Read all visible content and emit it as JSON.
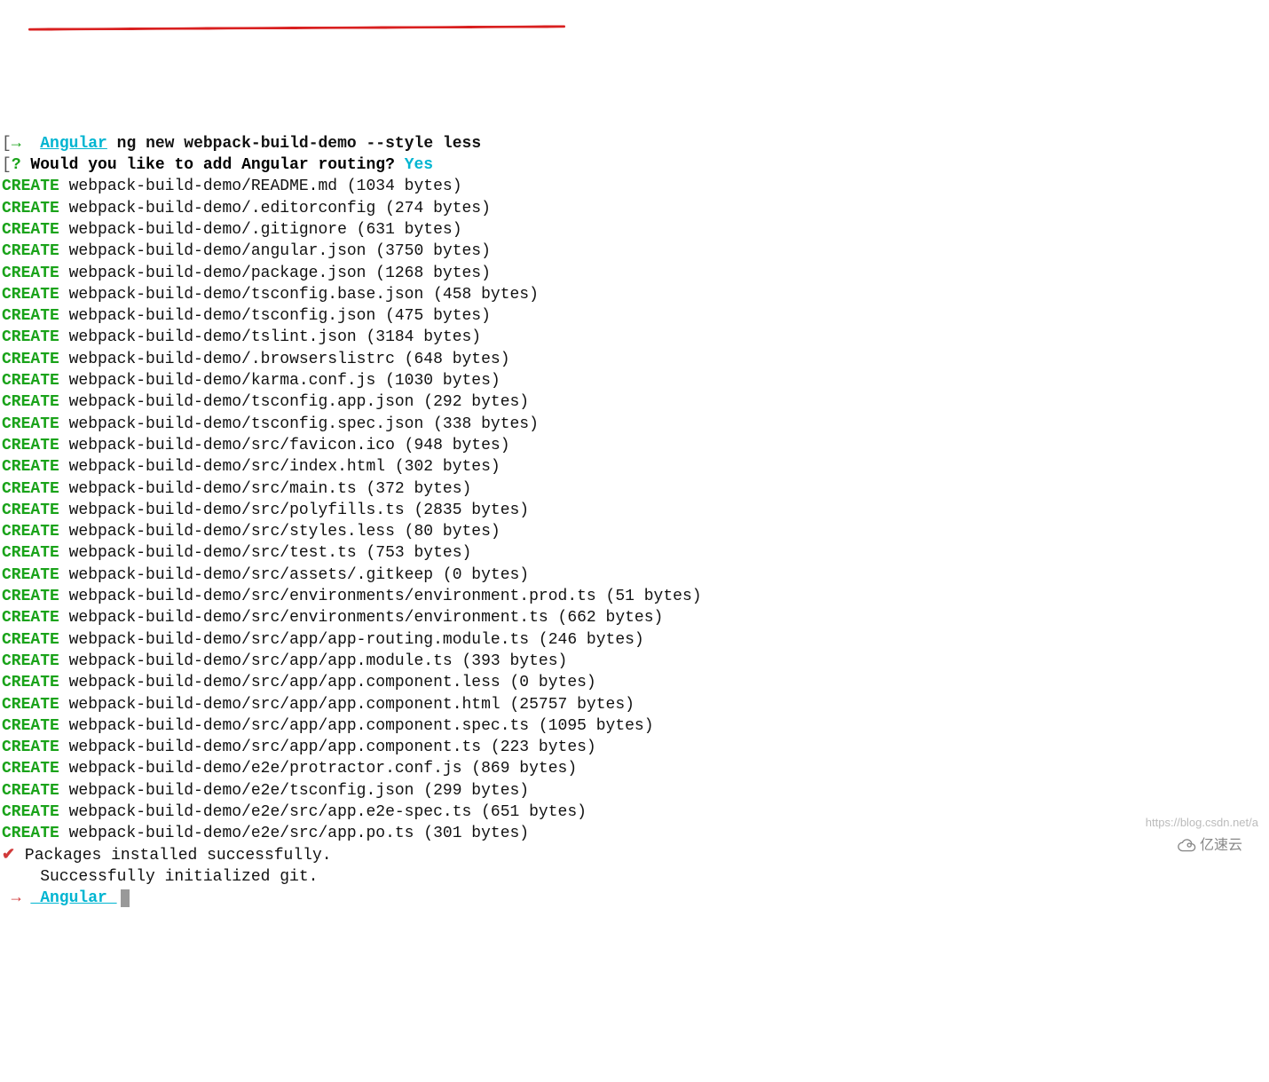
{
  "prompt1": {
    "bracket": "[",
    "arrow": "→",
    "label": "Angular",
    "command": " ng new webpack-build-demo --style less"
  },
  "prompt_question": {
    "bracket": "[",
    "qmark": "?",
    "text": " Would you like to add Angular routing?",
    "answer": " Yes"
  },
  "create_label": "CREATE",
  "files": [
    "webpack-build-demo/README.md (1034 bytes)",
    "webpack-build-demo/.editorconfig (274 bytes)",
    "webpack-build-demo/.gitignore (631 bytes)",
    "webpack-build-demo/angular.json (3750 bytes)",
    "webpack-build-demo/package.json (1268 bytes)",
    "webpack-build-demo/tsconfig.base.json (458 bytes)",
    "webpack-build-demo/tsconfig.json (475 bytes)",
    "webpack-build-demo/tslint.json (3184 bytes)",
    "webpack-build-demo/.browserslistrc (648 bytes)",
    "webpack-build-demo/karma.conf.js (1030 bytes)",
    "webpack-build-demo/tsconfig.app.json (292 bytes)",
    "webpack-build-demo/tsconfig.spec.json (338 bytes)",
    "webpack-build-demo/src/favicon.ico (948 bytes)",
    "webpack-build-demo/src/index.html (302 bytes)",
    "webpack-build-demo/src/main.ts (372 bytes)",
    "webpack-build-demo/src/polyfills.ts (2835 bytes)",
    "webpack-build-demo/src/styles.less (80 bytes)",
    "webpack-build-demo/src/test.ts (753 bytes)",
    "webpack-build-demo/src/assets/.gitkeep (0 bytes)",
    "webpack-build-demo/src/environments/environment.prod.ts (51 bytes)",
    "webpack-build-demo/src/environments/environment.ts (662 bytes)",
    "webpack-build-demo/src/app/app-routing.module.ts (246 bytes)",
    "webpack-build-demo/src/app/app.module.ts (393 bytes)",
    "webpack-build-demo/src/app/app.component.less (0 bytes)",
    "webpack-build-demo/src/app/app.component.html (25757 bytes)",
    "webpack-build-demo/src/app/app.component.spec.ts (1095 bytes)",
    "webpack-build-demo/src/app/app.component.ts (223 bytes)",
    "webpack-build-demo/e2e/protractor.conf.js (869 bytes)",
    "webpack-build-demo/e2e/tsconfig.json (299 bytes)",
    "webpack-build-demo/e2e/src/app.e2e-spec.ts (651 bytes)",
    "webpack-build-demo/e2e/src/app.po.ts (301 bytes)"
  ],
  "status1": {
    "check": "✔",
    "text": " Packages installed successfully."
  },
  "status2": "    Successfully initialized git.",
  "prompt2": {
    "arrow": " → ",
    "label": " Angular "
  },
  "watermark1": "https://blog.csdn.net/a",
  "watermark2": "亿速云"
}
